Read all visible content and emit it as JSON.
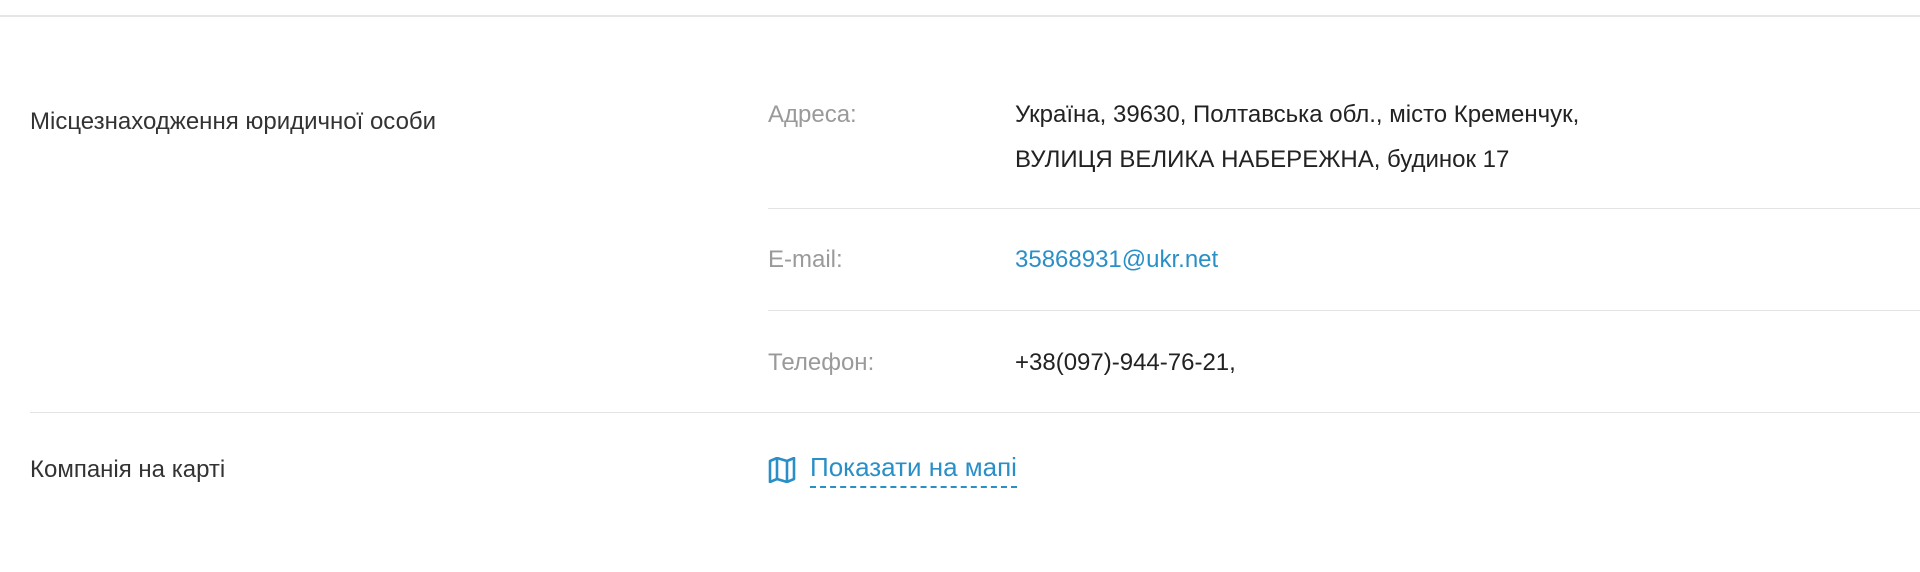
{
  "sections": {
    "location_label": "Місцезнаходження юридичної особи",
    "map_label": "Компанія на карті"
  },
  "fields": {
    "address_label": "Адреса:",
    "address_line1": "Україна, 39630, Полтавська обл., місто Кременчук,",
    "address_line2": "ВУЛИЦЯ ВЕЛИКА НАБЕРЕЖНА, будинок 17",
    "email_label": "E-mail:",
    "email_value": "35868931@ukr.net",
    "phone_label": "Телефон:",
    "phone_value": "+38(097)-944-76-21,"
  },
  "map": {
    "link_text": "Показати на мапі",
    "icon": "map-icon"
  },
  "colors": {
    "link": "#2a8fc7",
    "label_muted": "#9a9a9a",
    "text": "#333333",
    "divider": "#e3e3e3"
  }
}
